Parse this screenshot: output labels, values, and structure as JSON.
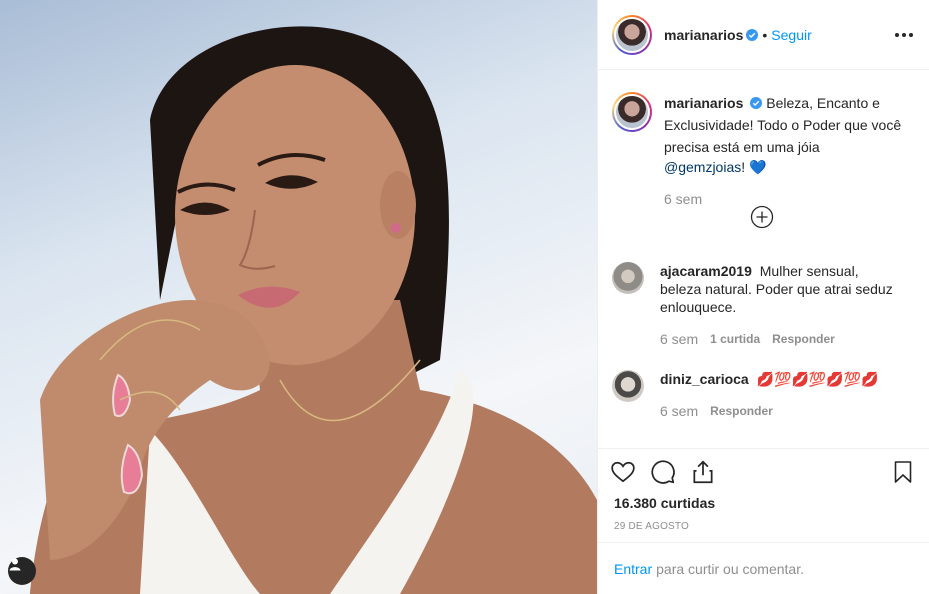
{
  "post": {
    "username": "marianarios",
    "follow_label": "Seguir",
    "caption_text": "Beleza, Encanto e Exclusividade! Todo o Poder que você precisa está em uma jóia",
    "caption_mention": "@gemzjoias",
    "caption_suffix": "!",
    "caption_emoji": "💙",
    "caption_time": "6 sem",
    "likes": "16.380 curtidas",
    "date": "29 DE AGOSTO"
  },
  "comments": [
    {
      "username": "ajacaram2019",
      "text": "Mulher sensual, beleza natural. Poder que atrai seduz enlouquece.",
      "time": "6 sem",
      "likes_label": "1 curtida",
      "reply_label": "Responder"
    },
    {
      "username": "diniz_carioca",
      "text": "💋💯💋💯💋💯💋",
      "time": "6 sem",
      "reply_label": "Responder"
    }
  ],
  "add_comment": {
    "enter_label": "Entrar",
    "placeholder": "para curtir ou comentar."
  },
  "colors": {
    "accent": "#0095f6",
    "muted": "#8e8e8e",
    "text": "#262626"
  },
  "icons": [
    "more-icon",
    "verified-icon",
    "load-more-icon",
    "heart-icon",
    "comment-icon",
    "share-icon",
    "bookmark-icon",
    "user-tag-icon"
  ]
}
